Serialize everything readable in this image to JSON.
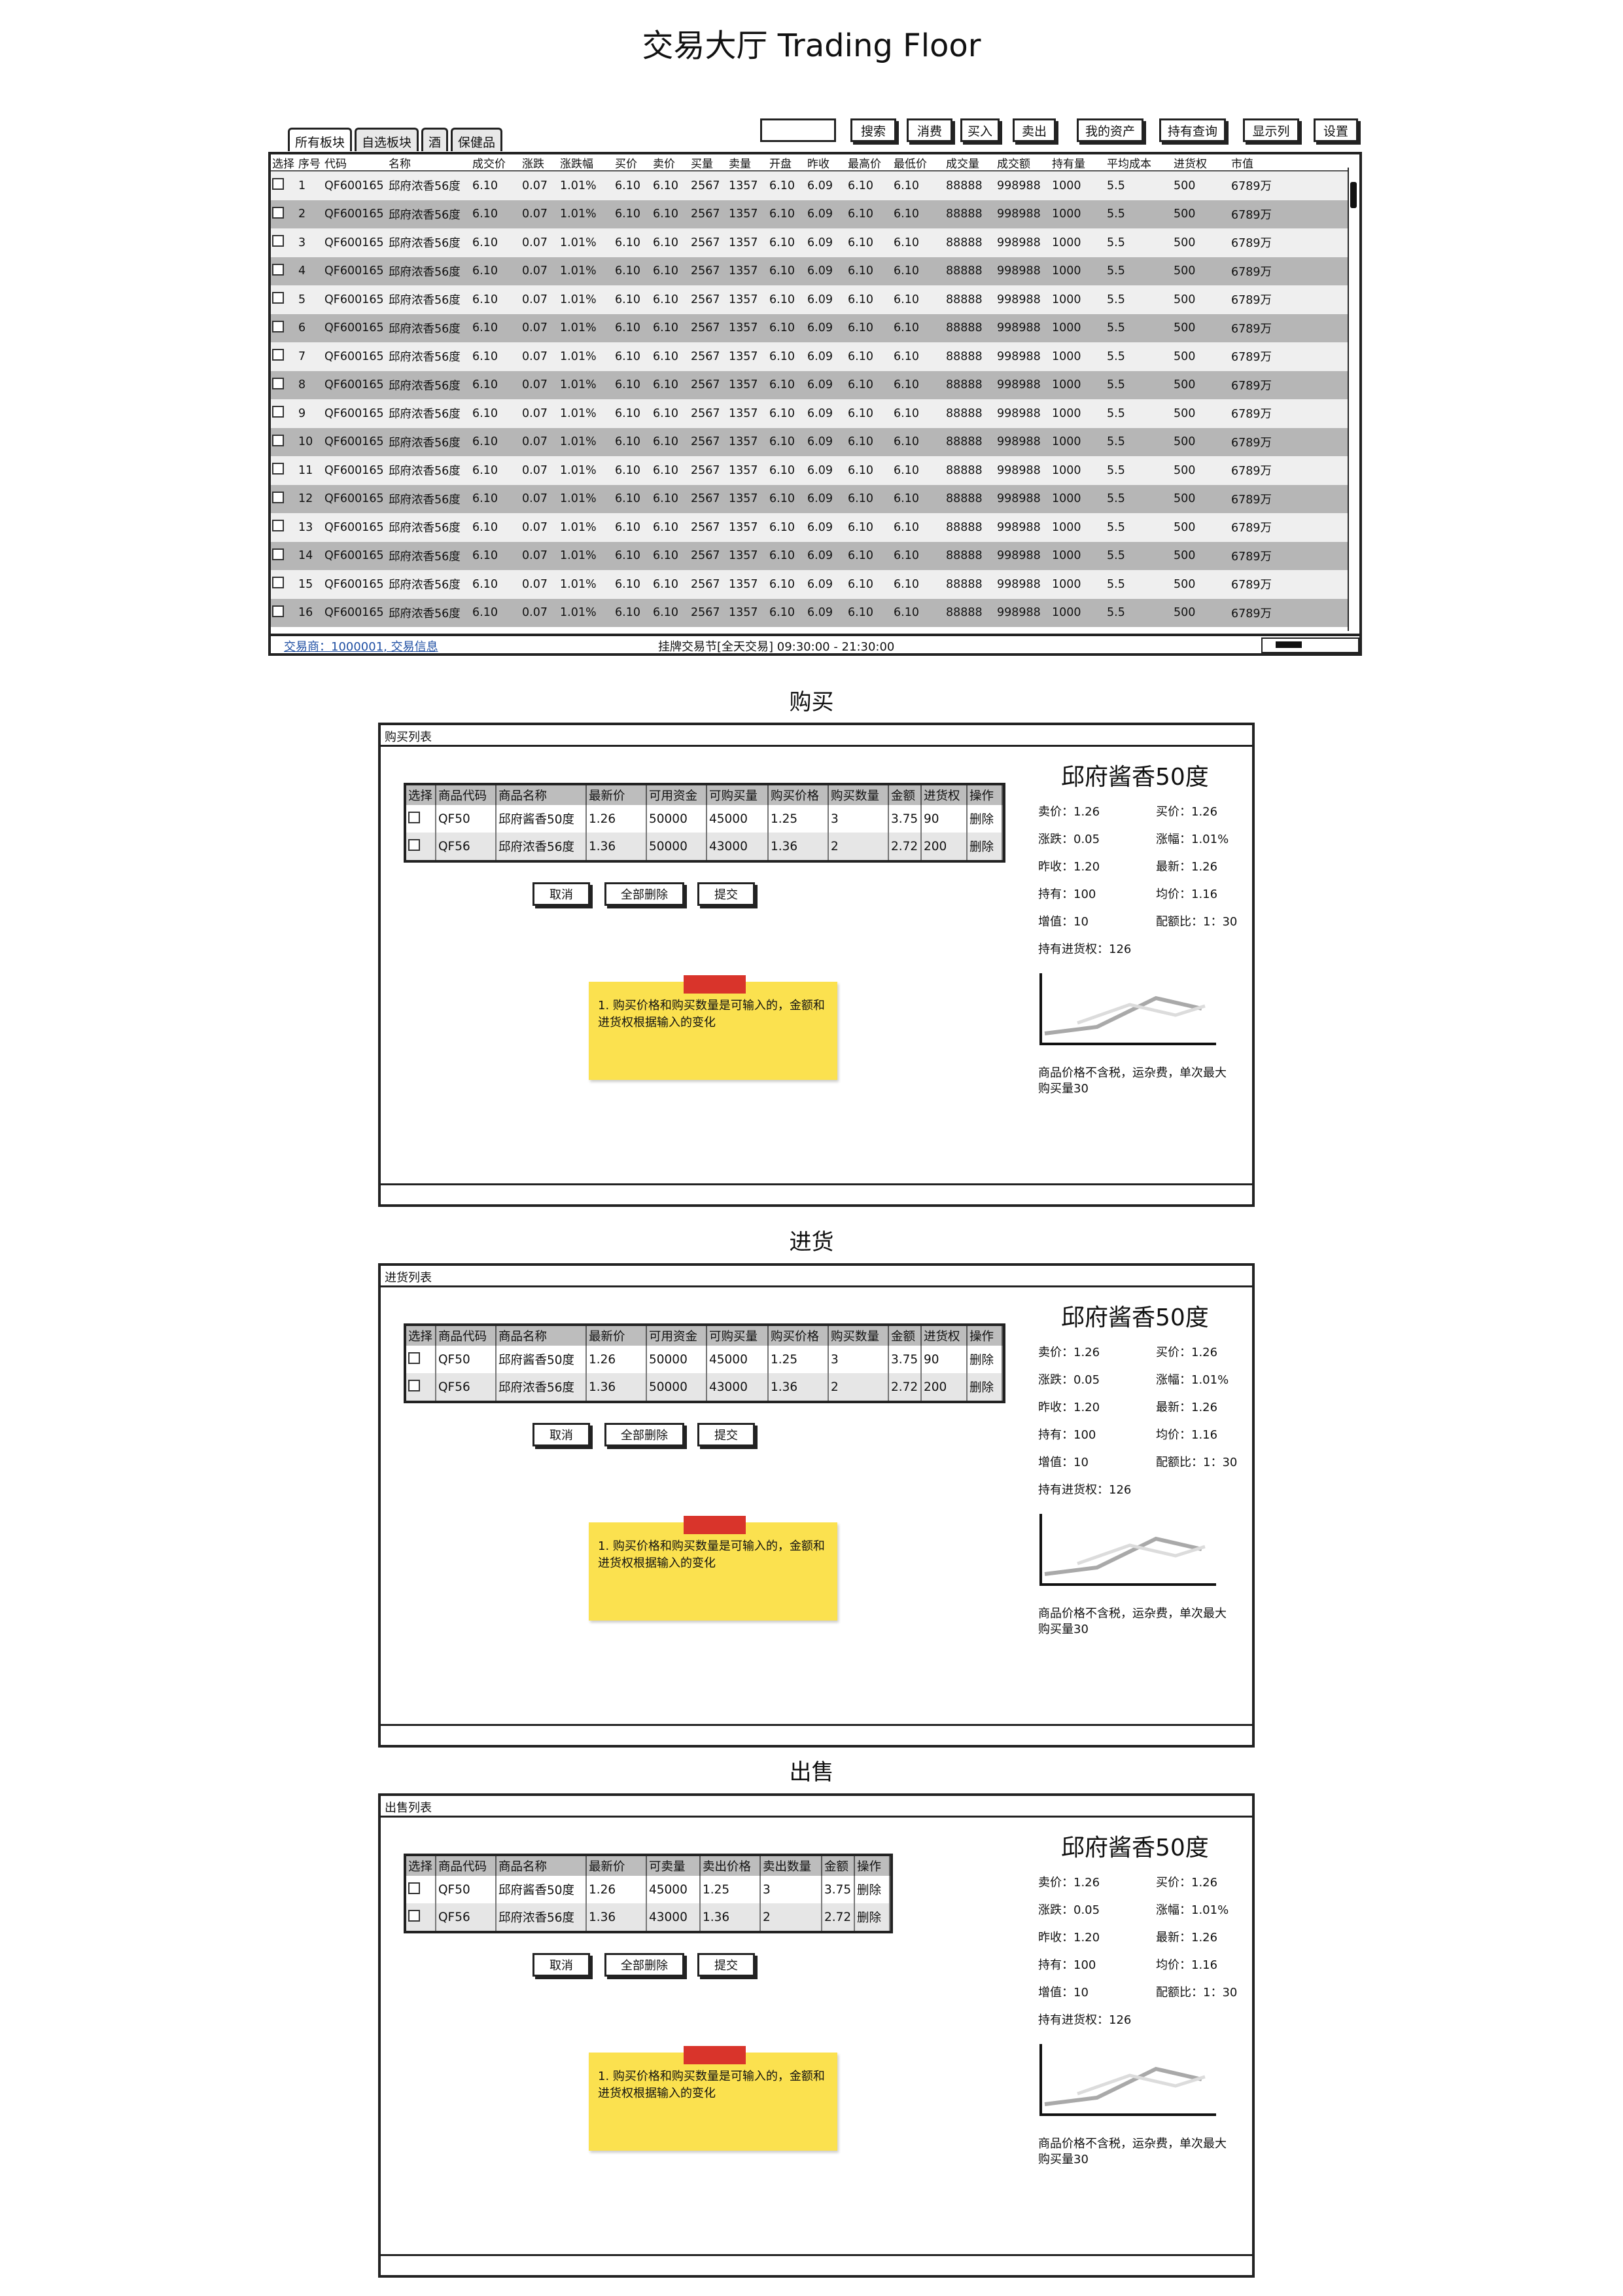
{
  "page_title": "交易大厅 Trading Floor",
  "trade": {
    "tabs": [
      "所有板块",
      "自选板块",
      "酒",
      "保健品"
    ],
    "toolbar": {
      "search": "搜索",
      "consume": "消费",
      "buy": "买入",
      "sell": "卖出",
      "assets": "我的资产",
      "holdings": "持有查询",
      "show_columns": "显示列",
      "settings": "设置"
    },
    "columns": [
      "选择",
      "序号",
      "代码",
      "名称",
      "成交价",
      "涨跌",
      "涨跌幅",
      "买价",
      "卖价",
      "买量",
      "卖量",
      "开盘",
      "昨收",
      "最高价",
      "最低价",
      "成交量",
      "成交额",
      "持有量",
      "平均成本",
      "进货权",
      "市值"
    ],
    "row_template": {
      "code": "QF600165",
      "name": "邱府浓香56度",
      "price": "6.10",
      "change": "0.07",
      "change_pct": "1.01%",
      "bid": "6.10",
      "ask": "6.10",
      "bid_qty": "2567",
      "ask_qty": "1357",
      "open": "6.10",
      "prev_close": "6.09",
      "high": "6.10",
      "low": "6.10",
      "volume": "88888",
      "turnover": "998988",
      "holding": "1000",
      "avg_cost": "5.5",
      "stock_right": "500",
      "market_value": "6789万"
    },
    "row_count": 16,
    "status_left": "交易商：1000001, 交易信息",
    "status_center": "挂牌交易节[全天交易] 09:30:00 - 21:30:00"
  },
  "sections": [
    {
      "heading": "购买",
      "panel_title": "购买列表",
      "columns": [
        "选择",
        "商品代码",
        "商品名称",
        "最新价",
        "可用资金",
        "可购买量",
        "购买价格",
        "购买数量",
        "金额",
        "进货权",
        "操作"
      ],
      "rows": [
        [
          "",
          "QF50",
          "邱府酱香50度",
          "1.26",
          "50000",
          "45000",
          "1.25",
          "3",
          "3.75",
          "90",
          "删除"
        ],
        [
          "",
          "QF56",
          "邱府浓香56度",
          "1.36",
          "50000",
          "43000",
          "1.36",
          "2",
          "2.72",
          "200",
          "删除"
        ]
      ]
    },
    {
      "heading": "进货",
      "panel_title": "进货列表",
      "columns": [
        "选择",
        "商品代码",
        "商品名称",
        "最新价",
        "可用资金",
        "可购买量",
        "购买价格",
        "购买数量",
        "金额",
        "进货权",
        "操作"
      ],
      "rows": [
        [
          "",
          "QF50",
          "邱府酱香50度",
          "1.26",
          "50000",
          "45000",
          "1.25",
          "3",
          "3.75",
          "90",
          "删除"
        ],
        [
          "",
          "QF56",
          "邱府浓香56度",
          "1.36",
          "50000",
          "43000",
          "1.36",
          "2",
          "2.72",
          "200",
          "删除"
        ]
      ]
    },
    {
      "heading": "出售",
      "panel_title": "出售列表",
      "columns": [
        "选择",
        "商品代码",
        "商品名称",
        "最新价",
        "可卖量",
        "卖出价格",
        "卖出数量",
        "金额",
        "操作"
      ],
      "rows": [
        [
          "",
          "QF50",
          "邱府酱香50度",
          "1.26",
          "45000",
          "1.25",
          "3",
          "3.75",
          "删除"
        ],
        [
          "",
          "QF56",
          "邱府浓香56度",
          "1.36",
          "43000",
          "1.36",
          "2",
          "2.72",
          "删除"
        ]
      ]
    }
  ],
  "buttons": {
    "cancel": "取消",
    "delete_all": "全部删除",
    "submit": "提交"
  },
  "sticky_note": "1. 购买价格和购买数量是可输入的，金额和进货权根据输入的变化",
  "product_info": {
    "title": "邱府酱香50度",
    "sell_price": "卖价：1.26",
    "buy_price": "买价：1.26",
    "change": "涨跌：0.05",
    "change_pct": "涨幅：1.01%",
    "prev_close": "昨收：1.20",
    "latest": "最新：1.26",
    "holding": "持有：100",
    "avg_price": "均价：1.16",
    "value_added": "增值：10",
    "ratio": "配额比：1：30",
    "stock_right": "持有进货权：126",
    "note": "商品价格不含税，运杂费，单次最大购买量30"
  },
  "colors": {
    "row_alt": "#b6b6b6",
    "row_norm": "#efefef",
    "sticky": "#fbe14f",
    "tape": "#d9342b"
  }
}
